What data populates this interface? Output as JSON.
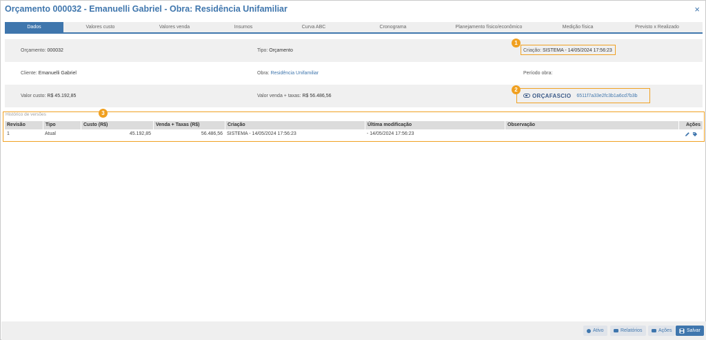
{
  "window": {
    "title": "Orçamento 000032 - Emanuelli Gabriel - Obra: Residência Unifamiliar",
    "close_glyph": "×"
  },
  "tabs": [
    {
      "label": "Dados",
      "active": true
    },
    {
      "label": "Valores custo"
    },
    {
      "label": "Valores venda"
    },
    {
      "label": "Insumos"
    },
    {
      "label": "Curva ABC"
    },
    {
      "label": "Cronograma"
    },
    {
      "label": "Planejamento físico/econômico"
    },
    {
      "label": "Medição física"
    },
    {
      "label": "Previsto x Realizado"
    }
  ],
  "info": {
    "orcamento_label": "Orçamento:",
    "orcamento_value": "000032",
    "tipo_label": "Tipo:",
    "tipo_value": "Orçamento",
    "criacao_label": "Criação:",
    "criacao_value": "SISTEMA - 14/05/2024 17:56:23",
    "cliente_label": "Cliente:",
    "cliente_value": "Emanuelli Gabriel",
    "obra_label": "Obra:",
    "obra_value": "Residência Unifamiliar",
    "periodo_label": "Período obra:",
    "valor_custo_label": "Valor custo:",
    "valor_custo_value": "R$ 45.192,85",
    "valor_venda_label": "Valor venda + taxas:",
    "valor_venda_value": "R$ 56.486,56",
    "orcafascio_logo": "ORÇAFASCIO",
    "orcafascio_hash": "6511f7a33e2fc3b1a6cd7b3b"
  },
  "badges": [
    "1",
    "2",
    "3"
  ],
  "history": {
    "title": "Histórico de versões",
    "columns": [
      "Revisão",
      "Tipo",
      "Custo (R$)",
      "Venda + Taxas (R$)",
      "Criação",
      "Última modificação",
      "Observação",
      "Ações"
    ],
    "rows": [
      {
        "revisao": "1",
        "tipo": "Atual",
        "custo": "45.192,85",
        "venda": "56.486,56",
        "criacao": "SISTEMA - 14/05/2024 17:56:23",
        "ultima": "- 14/05/2024 17:56:23",
        "observacao": ""
      }
    ]
  },
  "footer": {
    "ativo_label": "Ativo",
    "relatorios_label": "Relatórios",
    "acoes_label": "Ações",
    "salvar_label": "Salvar"
  },
  "colors": {
    "accent": "#3f76ad",
    "highlight": "#f0a020"
  }
}
